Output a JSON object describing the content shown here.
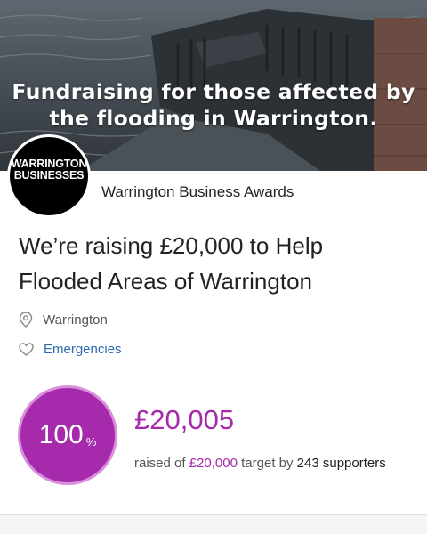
{
  "hero": {
    "line1": "Fundraising for those affected by",
    "line2": "the flooding in Warrington.",
    "image_icon": "flooded-garden-photo"
  },
  "organisation": {
    "logo_line1": "WARRINGTON",
    "logo_line2": "BUSINESSES",
    "name": "Warrington Business Awards"
  },
  "page": {
    "title": "We’re raising £20,000 to Help Flooded Areas of Warrington",
    "location": "Warrington",
    "location_icon": "map-pin-icon",
    "category": "Emergencies",
    "category_icon": "heart-icon"
  },
  "progress": {
    "percent": "100",
    "percent_sign": "%",
    "raised": "£20,005",
    "raised_of": "raised of",
    "target": "£20,000",
    "target_by": "target by",
    "supporters": "243 supporters"
  },
  "colors": {
    "accent": "#a62aac",
    "link": "#2a6bb0"
  }
}
